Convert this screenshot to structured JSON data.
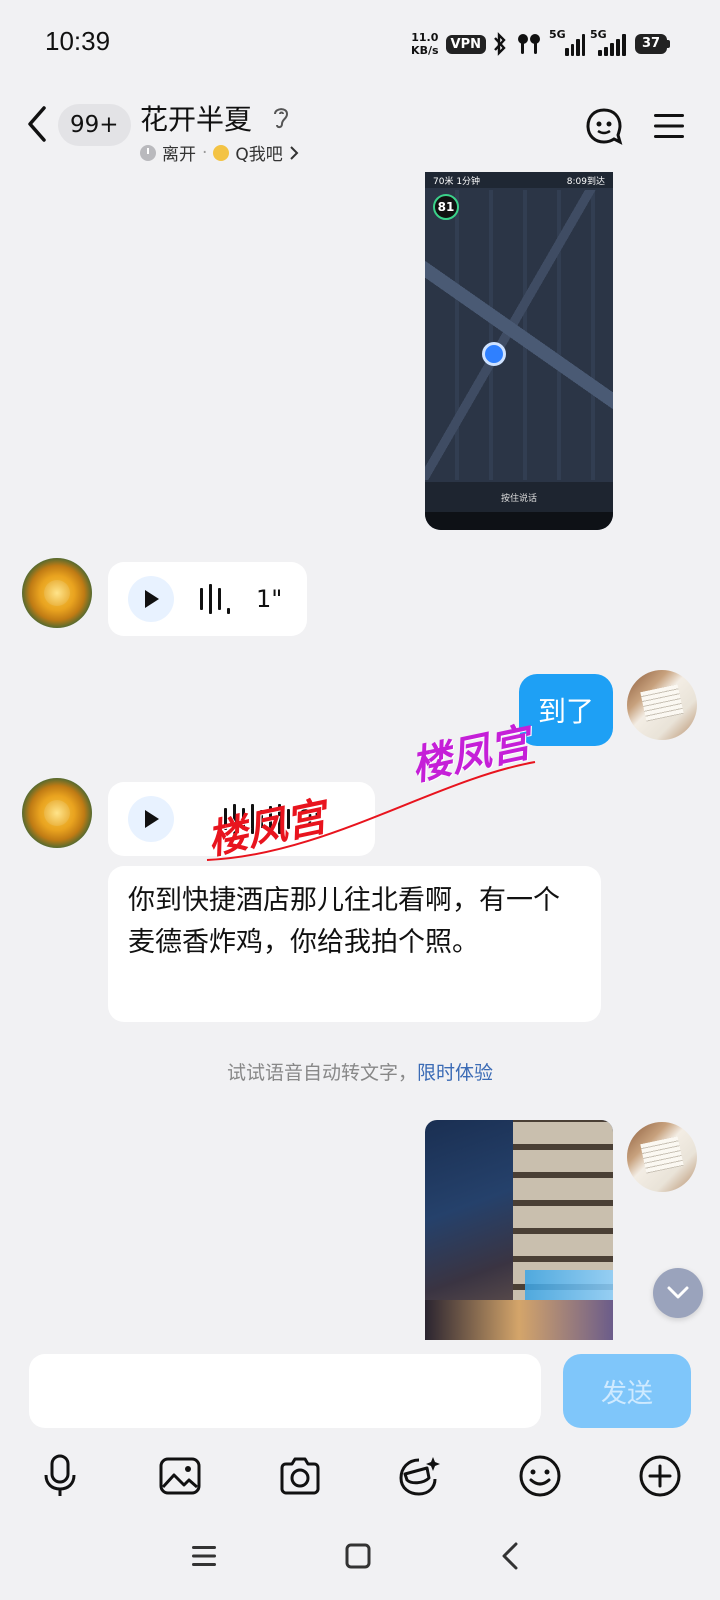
{
  "status_bar": {
    "time": "10:39",
    "net_speed_value": "11.0",
    "net_speed_unit": "KB/s",
    "vpn_label": "VPN",
    "signal1_label": "5G",
    "signal2_label": "5G",
    "battery_level": "37"
  },
  "header": {
    "back_icon": "chevron-left-icon",
    "unread_count": "99+",
    "title": "花开半夏",
    "presence": "离开",
    "separator": "·",
    "status_label": "Q我吧",
    "right_icons": [
      "robot-face-icon",
      "menu-icon"
    ]
  },
  "messages": {
    "map_image": {
      "distance": "70米",
      "time_left": "1分钟",
      "eta": "8:09到达",
      "speed": "81",
      "voice_hint": "按住说话"
    },
    "voice_1": {
      "duration": "1\""
    },
    "sent_text": "到了",
    "voice_2": {
      "duration": "9\""
    },
    "text_message": "你到快捷酒店那儿往北看啊，有一个麦德香炸鸡，你给我拍个照。",
    "tip": {
      "text": "试试语音自动转文字，",
      "link": "限时体验"
    }
  },
  "watermark": {
    "text_red": "楼凤宫",
    "text_purple": "楼凤宫"
  },
  "input": {
    "value": "",
    "placeholder": "",
    "send_label": "发送"
  },
  "toolbar": {
    "icons": [
      "microphone-icon",
      "image-icon",
      "camera-icon",
      "magic-face-icon",
      "emoji-icon",
      "plus-circle-icon"
    ]
  },
  "colors": {
    "accent": "#1ea0f5",
    "send_disabled": "#7fc6fa",
    "link": "#3b6bb5",
    "background": "#f1f1f3"
  }
}
